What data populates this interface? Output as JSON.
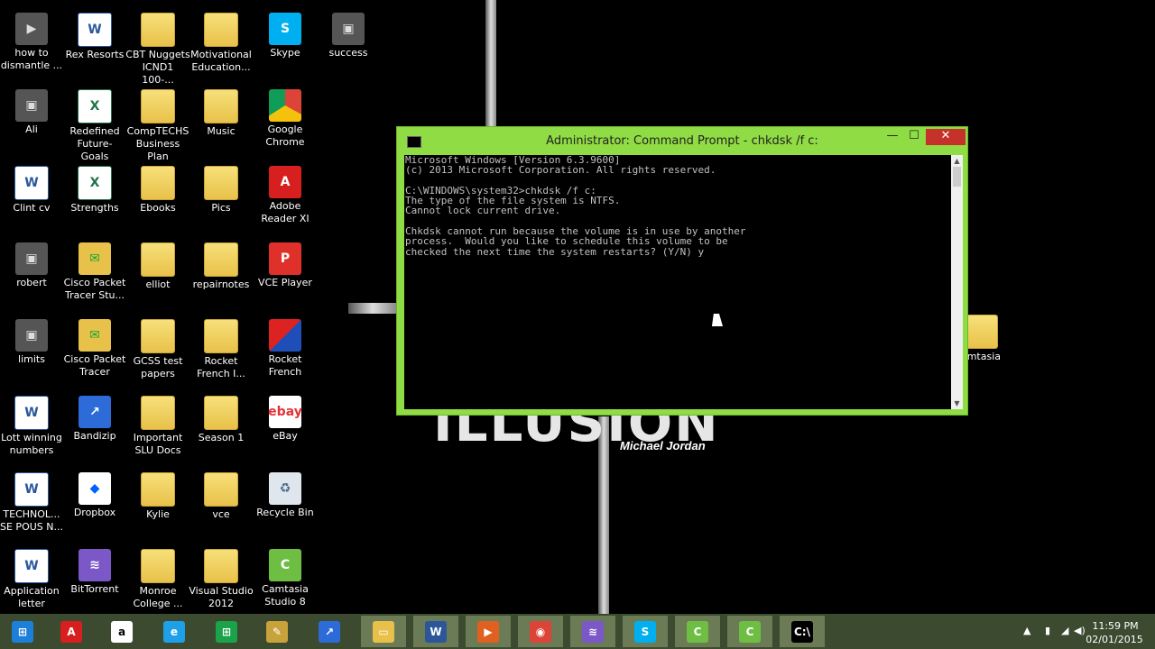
{
  "wallpaper": {
    "big_text": "ILLUSION",
    "author": "Michael Jordan"
  },
  "desktop_icons": [
    {
      "label": "how to dismantle ...",
      "icon": "video-thumbnail-icon"
    },
    {
      "label": "Rex Resorts",
      "icon": "word-document-icon"
    },
    {
      "label": "CBT Nuggets ICND1 100-...",
      "icon": "folder-icon"
    },
    {
      "label": "Motivational Education...",
      "icon": "folder-icon"
    },
    {
      "label": "Skype",
      "icon": "skype-icon"
    },
    {
      "label": "success",
      "icon": "image-thumbnail-icon"
    },
    {
      "label": "Ali",
      "icon": "image-thumbnail-icon"
    },
    {
      "label": "Redefined Future- Goals",
      "icon": "excel-document-icon"
    },
    {
      "label": "CompTECHS Business Plan",
      "icon": "folder-icon"
    },
    {
      "label": "Music",
      "icon": "folder-icon"
    },
    {
      "label": "Google Chrome",
      "icon": "chrome-icon"
    },
    {
      "label": "Clint cv",
      "icon": "word-document-icon"
    },
    {
      "label": "Strengths",
      "icon": "excel-document-icon"
    },
    {
      "label": "Ebooks",
      "icon": "folder-icon"
    },
    {
      "label": "Pics",
      "icon": "folder-icon"
    },
    {
      "label": "Adobe Reader XI",
      "icon": "adobe-reader-icon"
    },
    {
      "label": "robert",
      "icon": "image-thumbnail-icon"
    },
    {
      "label": "Cisco Packet Tracer Stu...",
      "icon": "cisco-packet-tracer-icon"
    },
    {
      "label": "elliot",
      "icon": "folder-icon"
    },
    {
      "label": "repairnotes",
      "icon": "folder-icon"
    },
    {
      "label": "VCE Player",
      "icon": "vce-player-icon"
    },
    {
      "label": "limits",
      "icon": "image-thumbnail-icon"
    },
    {
      "label": "Cisco Packet Tracer",
      "icon": "cisco-packet-tracer-icon"
    },
    {
      "label": "GCSS test papers",
      "icon": "folder-icon"
    },
    {
      "label": "Rocket French I...",
      "icon": "folder-icon"
    },
    {
      "label": "Rocket French",
      "icon": "rocket-french-icon"
    },
    {
      "label": "Lott winning numbers",
      "icon": "word-document-icon"
    },
    {
      "label": "Bandizip",
      "icon": "bandizip-icon"
    },
    {
      "label": "Important SLU Docs",
      "icon": "folder-icon"
    },
    {
      "label": "Season 1",
      "icon": "folder-icon"
    },
    {
      "label": "eBay",
      "icon": "ebay-icon"
    },
    {
      "label": "TECHNOL... SE POUS N...",
      "icon": "word-document-icon"
    },
    {
      "label": "Dropbox",
      "icon": "dropbox-icon"
    },
    {
      "label": "Kylie",
      "icon": "folder-icon"
    },
    {
      "label": "vce",
      "icon": "folder-icon"
    },
    {
      "label": "Recycle Bin",
      "icon": "recycle-bin-icon"
    },
    {
      "label": "Application letter",
      "icon": "word-document-icon"
    },
    {
      "label": "BitTorrent",
      "icon": "bittorrent-icon"
    },
    {
      "label": "Monroe College ...",
      "icon": "folder-icon"
    },
    {
      "label": "Visual Studio 2012",
      "icon": "folder-icon"
    },
    {
      "label": "Camtasia Studio 8",
      "icon": "camtasia-icon"
    },
    {
      "label": "amtasia",
      "icon": "folder-icon"
    }
  ],
  "cmd": {
    "title": "Administrator: Command Prompt - chkdsk  /f c:",
    "lines": [
      "Microsoft Windows [Version 6.3.9600]",
      "(c) 2013 Microsoft Corporation. All rights reserved.",
      "",
      "C:\\WINDOWS\\system32>chkdsk /f c:",
      "The type of the file system is NTFS.",
      "Cannot lock current drive.",
      "",
      "Chkdsk cannot run because the volume is in use by another",
      "process.  Would you like to schedule this volume to be",
      "checked the next time the system restarts? (Y/N) y"
    ],
    "minimize": "—",
    "maximize": "☐",
    "close": "✕"
  },
  "taskbar": {
    "items": [
      "start-icon",
      "adobe-reader-icon",
      "amazon-icon",
      "internet-explorer-icon",
      "store-icon",
      "paint-icon",
      "bandizip-icon",
      "file-explorer-icon",
      "word-icon",
      "media-icon",
      "chrome-icon",
      "bittorrent-icon",
      "skype-icon",
      "camtasia-recorder-icon",
      "camtasia-icon",
      "command-prompt-icon"
    ],
    "time": "11:59 PM",
    "date": "02/01/2015"
  },
  "colors": {
    "window_frame": "#8fdc44",
    "close_button": "#c7312b",
    "taskbar": "#3c4a30"
  }
}
